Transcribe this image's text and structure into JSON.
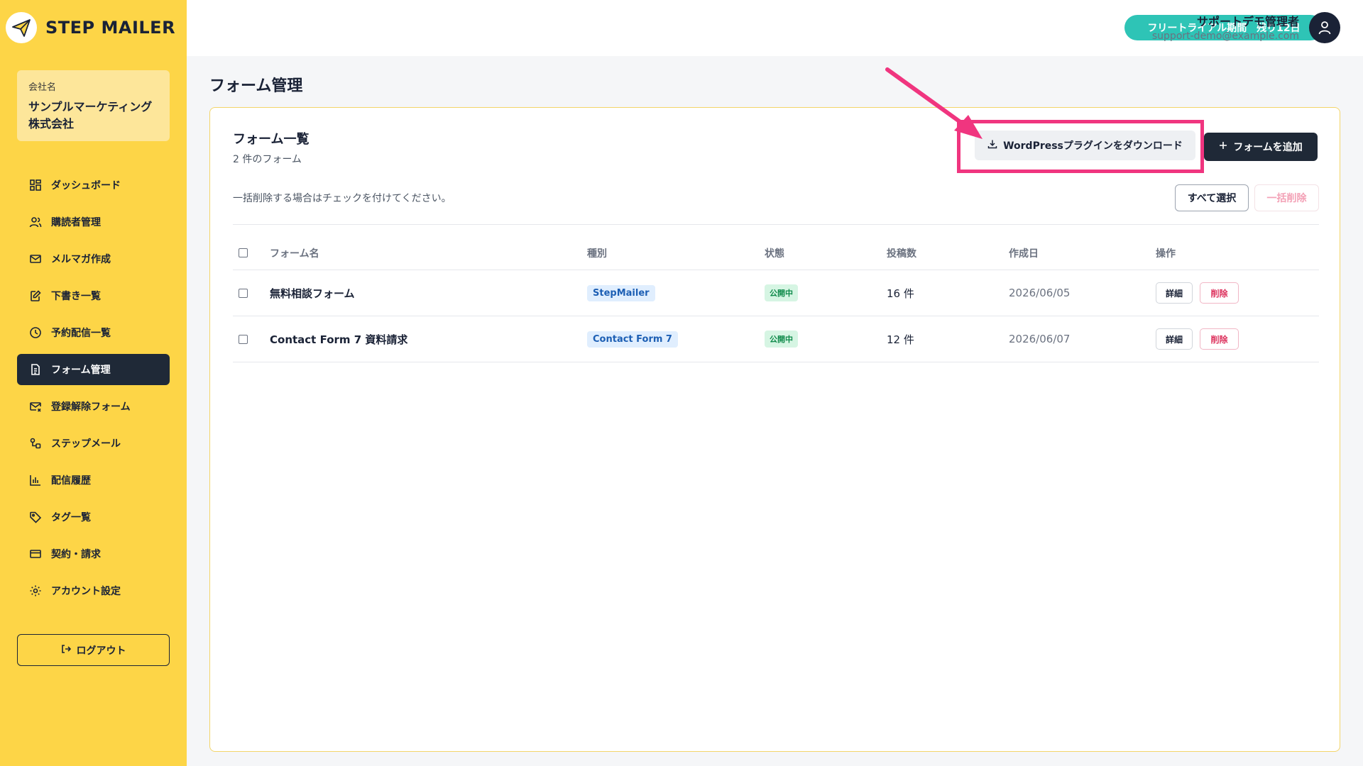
{
  "app": {
    "brand": "STEP MAILER",
    "accent": "#fdd547",
    "dark": "#1f2937",
    "highlight": "#f0357f"
  },
  "company": {
    "label": "会社名",
    "name_line1": "サンプルマーケティング",
    "name_line2": "株式会社"
  },
  "sidebar": {
    "items": [
      {
        "label": "ダッシュボード",
        "icon": "dashboard-icon"
      },
      {
        "label": "購読者管理",
        "icon": "users-icon"
      },
      {
        "label": "メルマガ作成",
        "icon": "mail-icon"
      },
      {
        "label": "下書き一覧",
        "icon": "edit-icon"
      },
      {
        "label": "予約配信一覧",
        "icon": "clock-icon"
      },
      {
        "label": "フォーム管理",
        "icon": "document-icon",
        "active": true
      },
      {
        "label": "登録解除フォーム",
        "icon": "mail-x-icon"
      },
      {
        "label": "ステップメール",
        "icon": "flow-icon"
      },
      {
        "label": "配信履歴",
        "icon": "bar-chart-icon"
      },
      {
        "label": "タグ一覧",
        "icon": "tag-icon"
      },
      {
        "label": "契約・請求",
        "icon": "credit-card-icon"
      },
      {
        "label": "アカウント設定",
        "icon": "gear-icon"
      }
    ],
    "logout": "ログアウト"
  },
  "header": {
    "trial": "フリートライアル期間　残り12日",
    "user_name": "サポートデモ管理者",
    "user_email": "support-demo@example.com"
  },
  "page": {
    "title": "フォーム管理"
  },
  "card": {
    "title": "フォーム一覧",
    "subtitle": "2 件のフォーム",
    "wp_button": "WordPressプラグインをダウンロード",
    "add_button": "フォームを追加",
    "hint": "一括削除する場合はチェックを付けてください。",
    "select_all": "すべて選択",
    "bulk_delete": "一括削除"
  },
  "table": {
    "headers": [
      "フォーム名",
      "種別",
      "状態",
      "投稿数",
      "作成日",
      "操作"
    ],
    "rows": [
      {
        "name": "無料相談フォーム",
        "type": "StepMailer",
        "status": "公開中",
        "count": "16 件",
        "date": "2026/06/05",
        "detail": "詳細",
        "delete": "削除"
      },
      {
        "name": "Contact Form 7 資料請求",
        "type": "Contact Form 7",
        "status": "公開中",
        "count": "12 件",
        "date": "2026/06/07",
        "detail": "詳細",
        "delete": "削除"
      }
    ]
  }
}
